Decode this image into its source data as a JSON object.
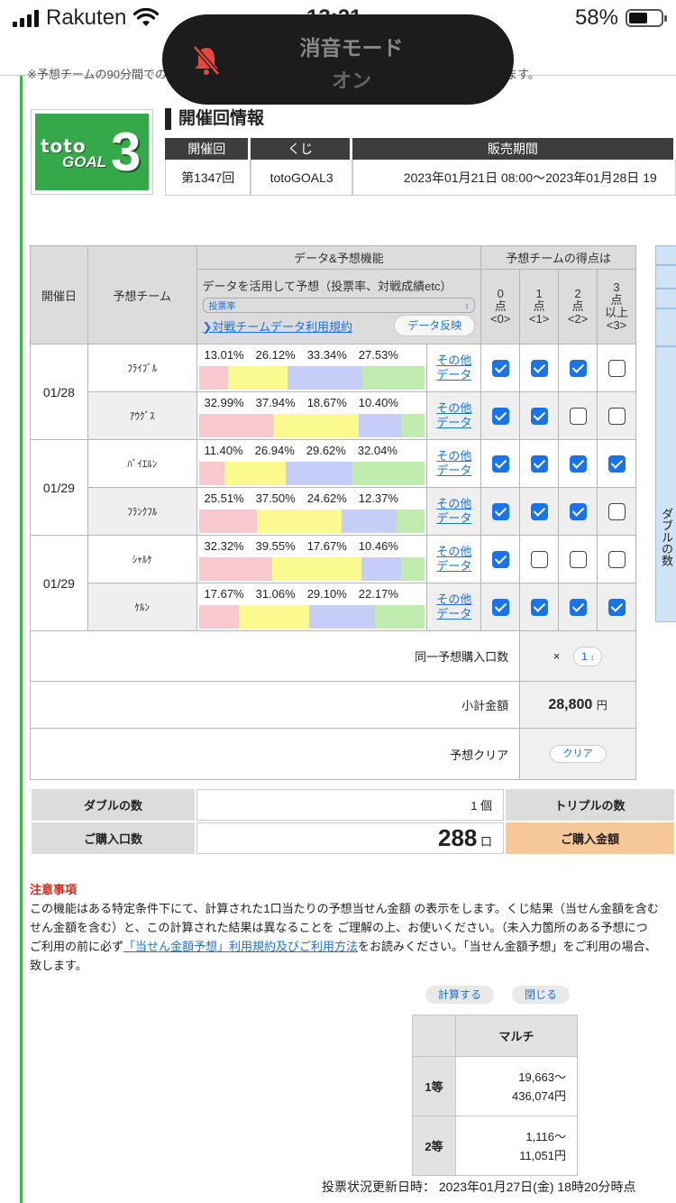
{
  "status": {
    "carrier": "Rakuten",
    "time": "13:21",
    "battery": "58%",
    "battery_level": 0.58
  },
  "toast": {
    "title": "消音モード",
    "state": "オン"
  },
  "clipped_note": "※予想チームの90分間での得点数を選択してください。得点数に応じて当せん金額を予想します。",
  "logo": {
    "line1": "toto",
    "line2": "GOAL",
    "digit": "3"
  },
  "info": {
    "title": "開催回情報",
    "headers": [
      "開催回",
      "くじ",
      "販売期間"
    ],
    "round": "第1347回",
    "lottery": "totoGOAL3",
    "period": "2023年01月21日 08:00～2023年01月28日 19"
  },
  "table": {
    "h_date": "開催日",
    "h_team": "予想チーム",
    "h_data": "データ&予想機能",
    "h_score": "予想チームの得点は",
    "data_desc": "データを活用して予想（投票率、対戦成績etc）",
    "select_value": "投票率",
    "terms_link": "対戦チームデータ利用規約",
    "reflect_button": "データ反映",
    "score_cols": [
      {
        "line1": "0",
        "line2": "点",
        "line3": "<0>"
      },
      {
        "line1": "1",
        "line2": "点",
        "line3": "<1>"
      },
      {
        "line1": "2",
        "line2": "点",
        "line3": "<2>"
      },
      {
        "line1": "3",
        "line2": "点",
        "line3": "以上",
        "line4": "<3>"
      }
    ],
    "other_link_1": "その他",
    "other_link_2": "データ",
    "bar_colors": [
      "#f7c9ce",
      "#fafa8f",
      "#c6cef8",
      "#c1ecb0"
    ],
    "rows": [
      {
        "date": "01/28",
        "team": "ﾌﾗｲﾌﾞﾙ",
        "pcts": [
          "13.01%",
          "26.12%",
          "33.34%",
          "27.53%"
        ],
        "values": [
          13.01,
          26.12,
          33.34,
          27.53
        ],
        "checks": [
          true,
          true,
          true,
          false
        ]
      },
      {
        "date": "",
        "team": "ｱｳｸﾞｽ",
        "pcts": [
          "32.99%",
          "37.94%",
          "18.67%",
          "10.40%"
        ],
        "values": [
          32.99,
          37.94,
          18.67,
          10.4
        ],
        "checks": [
          true,
          true,
          false,
          false
        ]
      },
      {
        "date": "01/29",
        "team": "ﾊﾞｲｴﾙﾝ",
        "pcts": [
          "11.40%",
          "26.94%",
          "29.62%",
          "32.04%"
        ],
        "values": [
          11.4,
          26.94,
          29.62,
          32.04
        ],
        "checks": [
          true,
          true,
          true,
          true
        ]
      },
      {
        "date": "",
        "team": "ﾌﾗﾝｸﾌﾙ",
        "pcts": [
          "25.51%",
          "37.50%",
          "24.62%",
          "12.37%"
        ],
        "values": [
          25.51,
          37.5,
          24.62,
          12.37
        ],
        "checks": [
          true,
          true,
          true,
          false
        ]
      },
      {
        "date": "01/29",
        "team": "ｼｬﾙｹ",
        "pcts": [
          "32.32%",
          "39.55%",
          "17.67%",
          "10.46%"
        ],
        "values": [
          32.32,
          39.55,
          17.67,
          10.46
        ],
        "checks": [
          true,
          false,
          false,
          false
        ]
      },
      {
        "date": "",
        "team": "ｹﾙﾝ",
        "pcts": [
          "17.67%",
          "31.06%",
          "29.10%",
          "22.17%"
        ],
        "values": [
          17.67,
          31.06,
          29.1,
          22.17
        ],
        "checks": [
          true,
          true,
          true,
          true
        ]
      }
    ],
    "multiplier_label": "同一予想購入口数",
    "multiplier_prefix": "×",
    "multiplier_value": "1",
    "subtotal_label": "小計金額",
    "subtotal_value": "28,800",
    "subtotal_unit": "円",
    "clear_label": "予想クリア",
    "clear_button": "クリア"
  },
  "side_column_text": "ダブルの数",
  "counts": {
    "double_label": "ダブルの数",
    "double_value": "1 個",
    "triple_label": "トリプルの数",
    "units_label": "ご購入口数",
    "units_value": "288",
    "units_suffix": "口",
    "amount_label": "ご購入金額"
  },
  "notes": {
    "title": "注意事項",
    "line1": "この機能はある特定条件下にて、計算された1口当たりの予想当せん金額 の表示をします。くじ結果（当せん金額を含む",
    "line2": "せん金額を含む）と、この計算された結果は異なることを ご理解の上、お使いください。（未入力箇所のある予想につ",
    "line3_pre": "ご利用の前に必ず",
    "line3_link": "「当せん金額予想」利用規約及びご利用方法",
    "line3_post": "をお読みください。「当せん金額予想」をご利用の場合、",
    "line4": "致します。"
  },
  "buttons": {
    "calc": "計算する",
    "close": "閉じる"
  },
  "prize": {
    "header": "マルチ",
    "rows": [
      {
        "rank": "1等",
        "low": "19,663～",
        "high": "436,074円"
      },
      {
        "rank": "2等",
        "low": "1,116～",
        "high": "11,051円"
      }
    ]
  },
  "updated_text": "投票状況更新日時： 2023年01月27日(金) 18時20分時点"
}
